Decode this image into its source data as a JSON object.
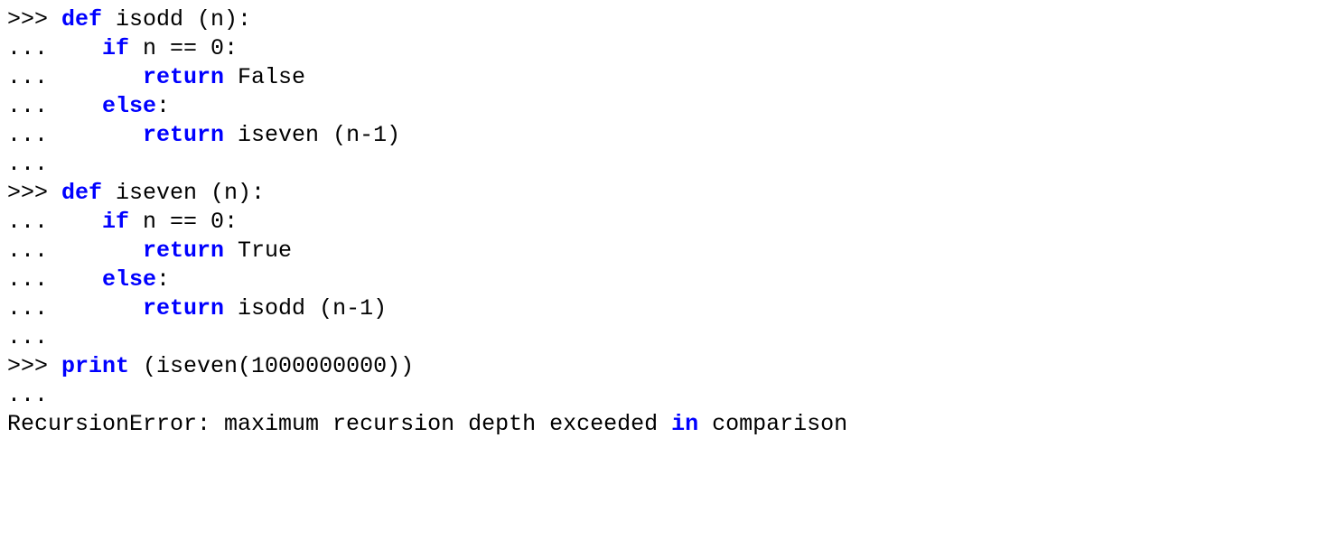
{
  "prompts": {
    "primary": ">>> ",
    "continuation": "... ",
    "continuation_bare": "..."
  },
  "keywords": {
    "def": "def",
    "if": "if",
    "return": "return",
    "else": "else",
    "print": "print",
    "in": "in"
  },
  "code": {
    "isodd_header_name": " isodd (n):",
    "if_zero_cond": " n == 0:",
    "return_false": " False",
    "else_colon": ":",
    "return_iseven_call": " iseven (n-1)",
    "iseven_header_name": " iseven (n):",
    "return_true": " True",
    "return_isodd_call": " isodd (n-1)",
    "print_call": " (iseven(1000000000))",
    "error_prefix": "RecursionError: maximum recursion depth exceeded ",
    "error_suffix": " comparison"
  },
  "indent": {
    "level1": "   ",
    "level2": "      "
  }
}
